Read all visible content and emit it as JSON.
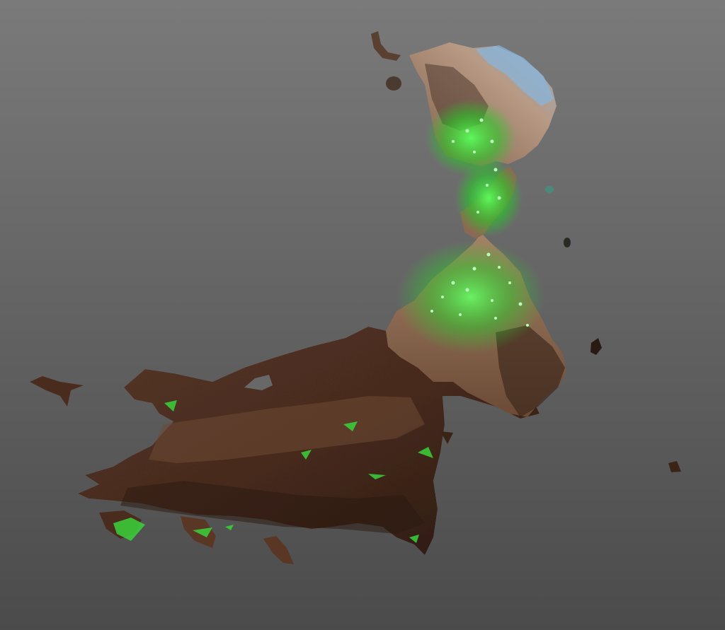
{
  "viewer": {
    "background_top": "#7a7a7a",
    "background_bottom": "#4b4b4b"
  },
  "model": {
    "colors": {
      "ground_dark": "#3a2418",
      "ground_mid": "#5e3a28",
      "ground_light": "#7a5238",
      "flesh": "#8c6a52",
      "flesh_light": "#a8866a",
      "sky_blue": "#7fa6c8",
      "fluor_green": "#38ff38"
    }
  }
}
